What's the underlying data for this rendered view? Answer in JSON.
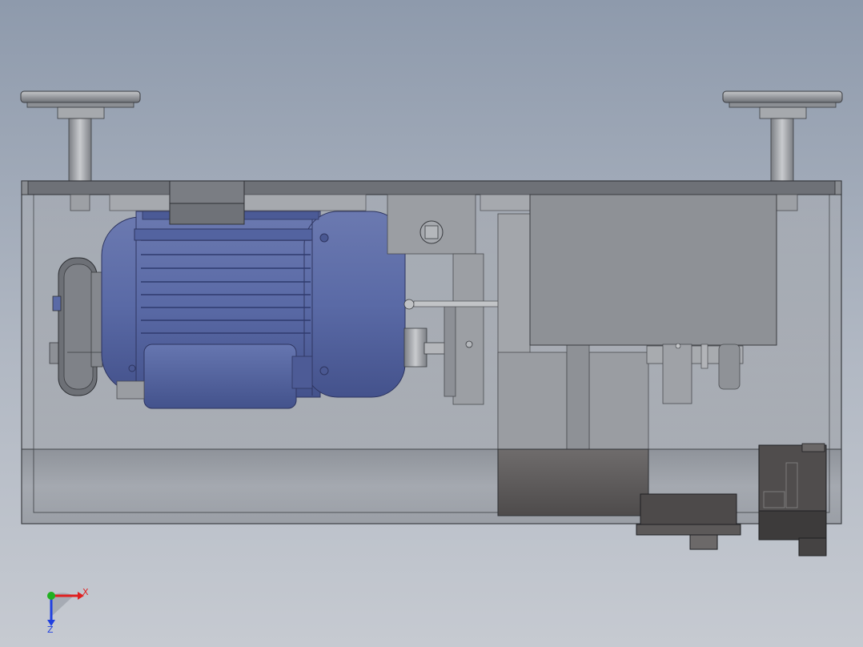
{
  "app": {
    "type": "3d-cad-viewport",
    "view": "front"
  },
  "colors": {
    "background_top": "#8e9aac",
    "background_bottom": "#c6cad1",
    "housing": "#8f949b",
    "motor_blue": "#5a6aa6",
    "motor_blue_dark": "#3f4e88",
    "axis_x": "#e02020",
    "axis_y": "#20b020",
    "axis_z": "#2040e0"
  },
  "triad": {
    "x_label": "X",
    "z_label": "Z",
    "icon": "coordinate-triad-icon"
  }
}
